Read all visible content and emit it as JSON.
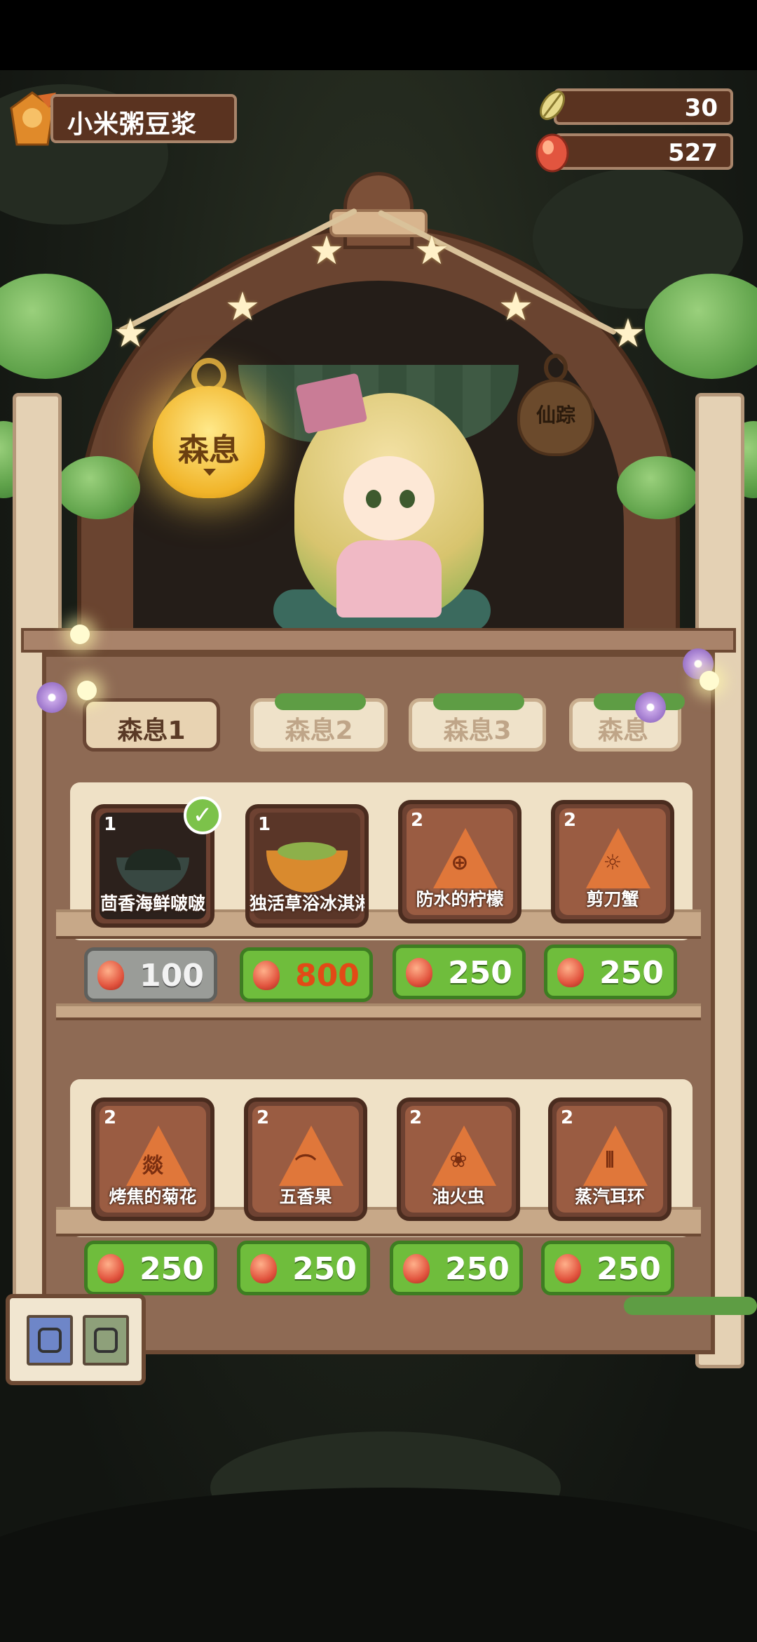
{
  "player": {
    "name": "小米粥豆浆"
  },
  "currencies": {
    "leaf": "30",
    "egg": "527"
  },
  "lanterns": {
    "active": "森息",
    "inactive": "仙踪"
  },
  "tabs": [
    {
      "label": "森息1",
      "active": true
    },
    {
      "label": "森息2",
      "active": false
    },
    {
      "label": "森息3",
      "active": false
    },
    {
      "label": "森息",
      "active": false
    }
  ],
  "shelves": [
    {
      "items": [
        {
          "level": "1",
          "name": "茴香海鲜啵啵",
          "kind": "dish",
          "owned": true,
          "price": "100",
          "price_state": "disabled"
        },
        {
          "level": "1",
          "name": "独活草浴冰淇淋",
          "kind": "bowl",
          "owned": false,
          "price": "800",
          "price_state": "highlight"
        },
        {
          "level": "2",
          "name": "防水的柠檬",
          "kind": "rune",
          "glyph": "⊕",
          "owned": false,
          "price": "250",
          "price_state": "normal"
        },
        {
          "level": "2",
          "name": "剪刀蟹",
          "kind": "rune",
          "glyph": "☼",
          "owned": false,
          "price": "250",
          "price_state": "normal"
        }
      ]
    },
    {
      "items": [
        {
          "level": "2",
          "name": "烤焦的菊花",
          "kind": "rune",
          "glyph": "燚",
          "owned": false,
          "price": "250",
          "price_state": "normal"
        },
        {
          "level": "2",
          "name": "五香果",
          "kind": "rune",
          "glyph": "⌒",
          "owned": false,
          "price": "250",
          "price_state": "normal"
        },
        {
          "level": "2",
          "name": "油火虫",
          "kind": "rune",
          "glyph": "❀",
          "owned": false,
          "price": "250",
          "price_state": "normal"
        },
        {
          "level": "2",
          "name": "蒸汽耳环",
          "kind": "rune",
          "glyph": "⦀",
          "owned": false,
          "price": "250",
          "price_state": "normal"
        }
      ]
    }
  ],
  "colors": {
    "price_green": "#6fbd3c",
    "price_gray": "#9a9c98",
    "price_highlight_text": "#e24a16",
    "lantern_active": "#f1b52a"
  },
  "icons": {
    "leaf": "leaf-icon",
    "egg": "egg-icon",
    "check": "check-icon"
  }
}
